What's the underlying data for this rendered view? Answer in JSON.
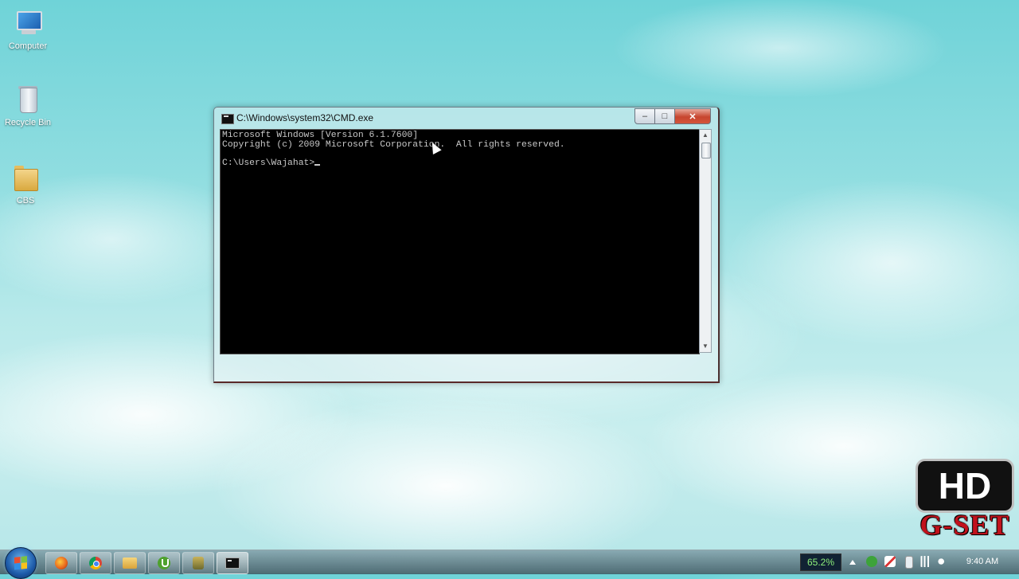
{
  "desktop": {
    "icons": [
      {
        "label": "Computer"
      },
      {
        "label": "Recycle Bin"
      },
      {
        "label": "CBS"
      }
    ]
  },
  "cmd_window": {
    "title": "C:\\Windows\\system32\\CMD.exe",
    "buttons": {
      "minimize": "–",
      "maximize": "□",
      "close": "✕"
    },
    "console_lines": [
      "Microsoft Windows [Version 6.1.7600]",
      "Copyright (c) 2009 Microsoft Corporation.  All rights reserved.",
      "",
      "C:\\Users\\Wajahat>"
    ]
  },
  "watermark": {
    "hd": "HD",
    "brand": "G-SET"
  },
  "taskbar": {
    "pinned": [
      "firefox-icon",
      "chrome-icon",
      "folder-icon",
      "utorrent-icon",
      "app-icon",
      "cmd-icon"
    ],
    "battery_percent": "65.2%",
    "clock": "9:40 AM"
  },
  "colors": {
    "console_bg": "#000000",
    "console_text": "#c8c8c8",
    "close_button": "#c7452f",
    "brand_red": "#c1121c"
  }
}
